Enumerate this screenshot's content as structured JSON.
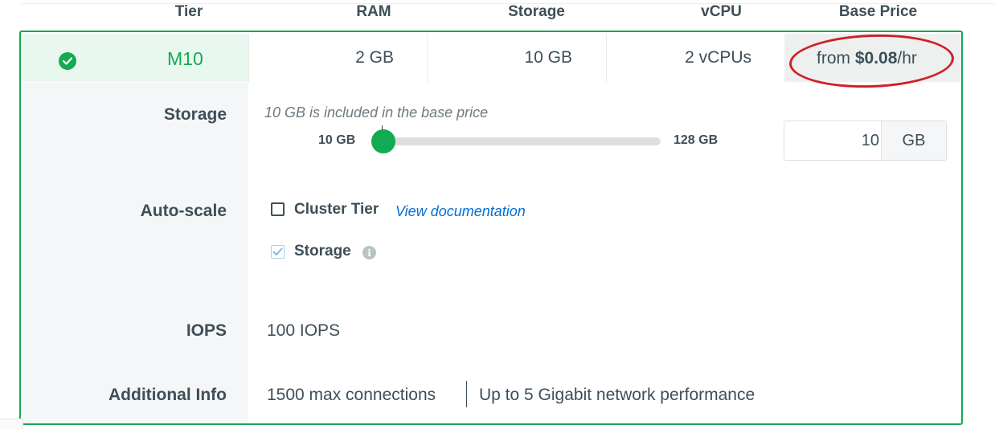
{
  "columns": {
    "tier": "Tier",
    "ram": "RAM",
    "storage": "Storage",
    "vcpu": "vCPU",
    "base_price": "Base Price"
  },
  "selected_tier": {
    "name": "M10",
    "ram": "2 GB",
    "storage": "10 GB",
    "vcpu": "2 vCPUs",
    "price_prefix": "from ",
    "price_amount": "$0.08",
    "price_suffix": "/hr"
  },
  "storage": {
    "label": "Storage",
    "helper": "10 GB is included in the base price",
    "slider_min_label": "10 GB",
    "slider_max_label": "128 GB",
    "slider_value_fraction": 0.0,
    "input_value": "10",
    "unit": "GB"
  },
  "autoscale": {
    "label": "Auto-scale",
    "cluster_tier_label": "Cluster Tier",
    "cluster_tier_checked": false,
    "doc_link": "View documentation",
    "storage_label": "Storage",
    "storage_checked": true
  },
  "iops": {
    "label": "IOPS",
    "value": "100 IOPS"
  },
  "additional_info": {
    "label": "Additional Info",
    "connections": "1500 max connections",
    "network": "Up to 5 Gigabit network performance"
  },
  "colors": {
    "accent_green": "#13aa52",
    "annotation_red": "#d21e2b",
    "link_blue": "#0070d8"
  }
}
